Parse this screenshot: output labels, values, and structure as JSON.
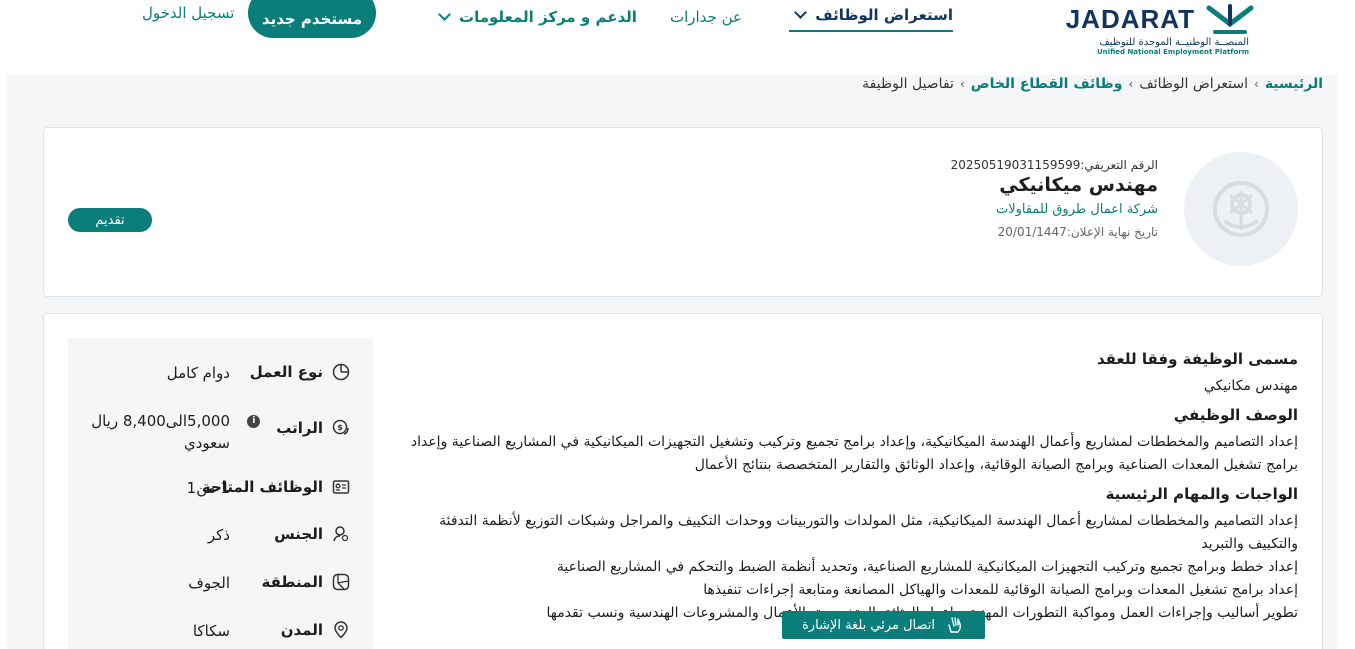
{
  "header": {
    "logo": {
      "wordmark": "JADARAT",
      "tagline_ar": "المنصــة الوطنيــة الموحدة للتوظيف",
      "tagline_en": "Unified National Employment Platform"
    },
    "nav": {
      "jobs_label": "استعراض الوظائف",
      "about_label": "عن جدارات",
      "support_label": "الدعم و مركز المعلومات"
    },
    "new_user_label": "مستخدم جديد",
    "login_label": "تسجيل الدخول"
  },
  "breadcrumb": {
    "home": "الرئيسية",
    "browse": "استعراض الوظائف",
    "private_sector": "وظائف القطاع الخاص",
    "current": "تفاصيل الوظيفة",
    "separator": "›"
  },
  "job": {
    "id_text": "الرقم التعريفي:20250519031159599",
    "title": "مهندس ميكانيكي",
    "company": "شركة اعمال طروق للمقاولات",
    "deadline_text": "تاريخ نهاية الإعلان:20/01/1447",
    "apply_label": "تقديم"
  },
  "details": {
    "contract_title_heading": "مسمى الوظيفة وفقا للعقد",
    "contract_title_value": "مهندس مكانيكي",
    "description_heading": "الوصف الوظيفي",
    "description_text": "إعداد التصاميم والمخططات لمشاريع وأعمال الهندسة الميكانيكية، وإعداد برامج تجميع وتركيب وتشغيل التجهيزات الميكانيكية في المشاريع الصناعية وإعداد برامج تشغيل المعدات الصناعية وبرامج الصيانة الوقائية، وإعداد الوثائق والتقارير المتخصصة بنتائج الأعمال",
    "duties_heading": "الواجبات والمهام الرئيسية",
    "duties": [
      "إعداد التصاميم والمخططات لمشاريع أعمال الهندسة الميكانيكية، مثل المولدات والتوربينات ووحدات التكييف والمراجل وشبكات التوزيع لأنظمة التدفئة والتكييف والتبريد",
      "إعداد خطط وبرامج تجميع وتركيب التجهيزات الميكانيكية للمشاريع الصناعية، وتحديد أنظمة الضبط والتحكم في المشاريع الصناعية",
      "إعداد برامج تشغيل المعدات وبرامج الصيانة الوقائية للمعدات والهياكل المصانعة ومتابعة إجراءات تنفيذها",
      "تطوير أساليب وإجراءات العمل ومواكبة التطورات المهنية، وإعداد الوثائق المتخصصة بالأعمال والمشروعات الهندسية ونسب تقدمها"
    ]
  },
  "attributes": {
    "work_type": {
      "label": "نوع العمل",
      "value": "دوام كامل"
    },
    "salary": {
      "label": "الراتب",
      "value": "5,000الى8,400 ريال سعودي"
    },
    "vacancies": {
      "label": "الوظائف المتاحة",
      "value": "1 من1"
    },
    "gender": {
      "label": "الجنس",
      "value": "ذكر"
    },
    "region": {
      "label": "المنطقة",
      "value": "الجوف"
    },
    "city": {
      "label": "المدن",
      "value": "سكاكا"
    }
  },
  "sign_language": {
    "label": "اتصال مرئي بلغة الإشارة"
  },
  "icons": {
    "work_type": "clock-icon",
    "salary": "money-icon",
    "vacancies": "id-card-icon",
    "gender": "gender-icon",
    "region": "map-icon",
    "city": "location-pin-icon",
    "salary_info": "info-icon",
    "sign": "hand-icon",
    "dropdown": "chevron-down-icon"
  },
  "colors": {
    "primary": "#0b7d7a",
    "navy": "#11355f",
    "background": "#f4f6f8"
  }
}
